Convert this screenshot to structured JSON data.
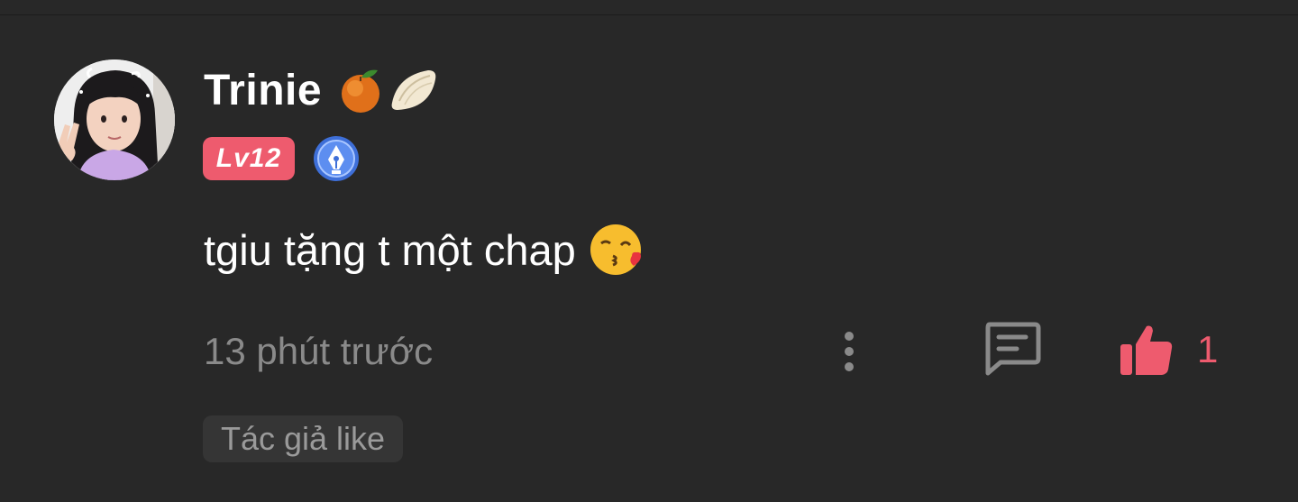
{
  "comment": {
    "author": {
      "name": "Trinie",
      "level_label": "Lv12",
      "decorations": [
        "orange-icon",
        "dumpling-icon"
      ],
      "medal_icon": "pen-nib-medal-icon"
    },
    "text": "tgiu tặng t một chap",
    "text_emoji": "kissing-face-icon",
    "timestamp": "13 phút trước",
    "like_count": "1",
    "author_like_label": "Tác giả like"
  },
  "colors": {
    "background": "#282828",
    "accent": "#ee5b6e",
    "muted_text": "#8a8a8a",
    "tag_background": "#353535"
  }
}
